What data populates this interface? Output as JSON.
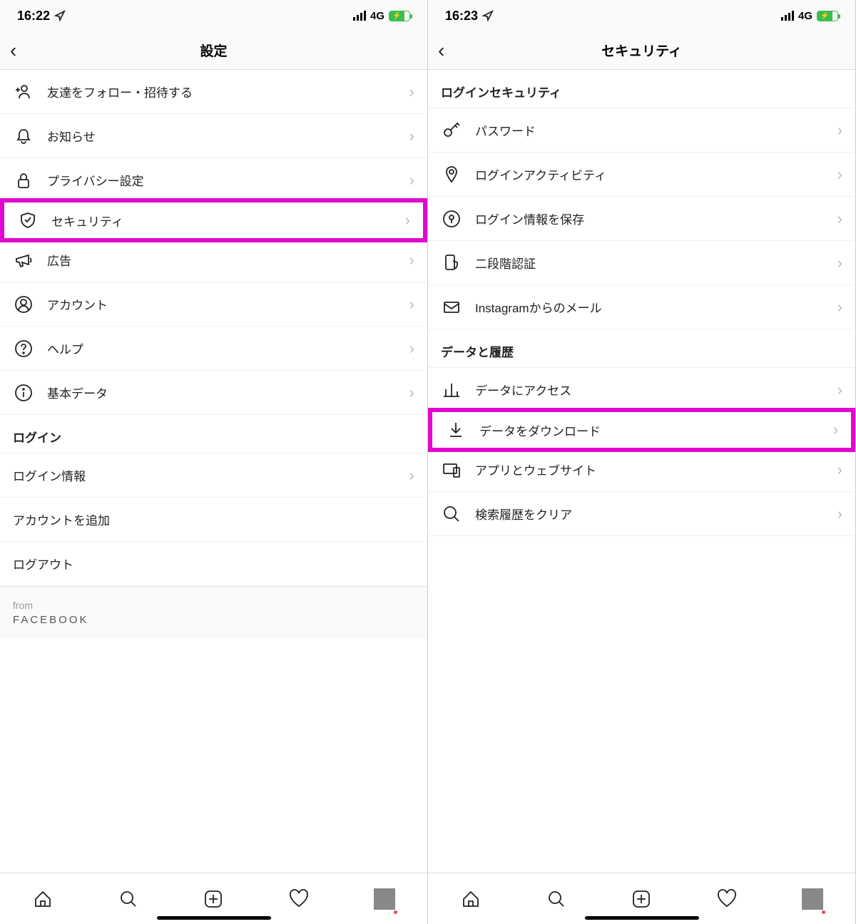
{
  "left": {
    "status": {
      "time": "16:22",
      "net": "4G"
    },
    "header": {
      "title": "設定"
    },
    "rows": [
      {
        "icon": "add-person-icon",
        "label": "友達をフォロー・招待する"
      },
      {
        "icon": "bell-icon",
        "label": "お知らせ"
      },
      {
        "icon": "lock-icon",
        "label": "プライバシー設定"
      },
      {
        "icon": "shield-check-icon",
        "label": "セキュリティ",
        "highlight": true
      },
      {
        "icon": "megaphone-icon",
        "label": "広告"
      },
      {
        "icon": "user-circle-icon",
        "label": "アカウント"
      },
      {
        "icon": "help-icon",
        "label": "ヘルプ"
      },
      {
        "icon": "info-icon",
        "label": "基本データ"
      }
    ],
    "login_section": {
      "header": "ログイン",
      "login_info": "ログイン情報",
      "add_account": "アカウントを追加",
      "logout": "ログアウト"
    },
    "footer": {
      "from": "from",
      "brand": "FACEBOOK"
    }
  },
  "right": {
    "status": {
      "time": "16:23",
      "net": "4G"
    },
    "header": {
      "title": "セキュリティ"
    },
    "section1": {
      "header": "ログインセキュリティ",
      "rows": [
        {
          "icon": "key-icon",
          "label": "パスワード"
        },
        {
          "icon": "pin-icon",
          "label": "ログインアクティビティ"
        },
        {
          "icon": "keyhole-icon",
          "label": "ログイン情報を保存"
        },
        {
          "icon": "phone-shield-icon",
          "label": "二段階認証"
        },
        {
          "icon": "mail-icon",
          "label": "Instagramからのメール"
        }
      ]
    },
    "section2": {
      "header": "データと履歴",
      "rows": [
        {
          "icon": "bars-icon",
          "label": "データにアクセス"
        },
        {
          "icon": "download-icon",
          "label": "データをダウンロード",
          "highlight": true
        },
        {
          "icon": "devices-icon",
          "label": "アプリとウェブサイト"
        },
        {
          "icon": "search-icon",
          "label": "検索履歴をクリア"
        }
      ]
    }
  }
}
